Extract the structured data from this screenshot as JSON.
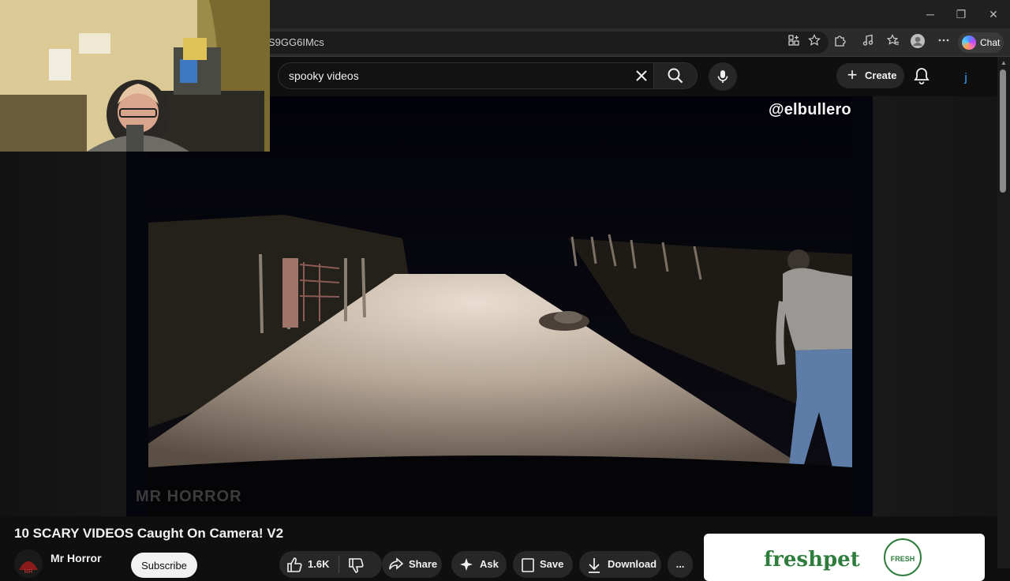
{
  "browser": {
    "url_fragment": "S9GG6IMcs",
    "chat_label": "Chat",
    "window_buttons": {
      "minimize": "─",
      "restore": "❐",
      "close": "✕"
    }
  },
  "youtube": {
    "search_value": "spooky videos",
    "create_label": "Create",
    "avatar_initial": "j"
  },
  "video": {
    "watermark_top": "@elbullero",
    "watermark_bottom": "MR HORROR",
    "title": "10 SCARY VIDEOS Caught On Camera! V2"
  },
  "channel": {
    "name": "Mr Horror",
    "subscribe_label": "Subscribe"
  },
  "actions": {
    "likes": "1.6K",
    "share": "Share",
    "ask": "Ask",
    "save": "Save",
    "download": "Download",
    "more": "..."
  },
  "ad": {
    "brand": "freshpet",
    "seal_text": "FRESH"
  },
  "colors": {
    "youtube_bg": "#0f0f0f",
    "chrome_bg": "#202020",
    "accent_link": "#3ea6ff",
    "ad_green": "#2e7d3c"
  }
}
